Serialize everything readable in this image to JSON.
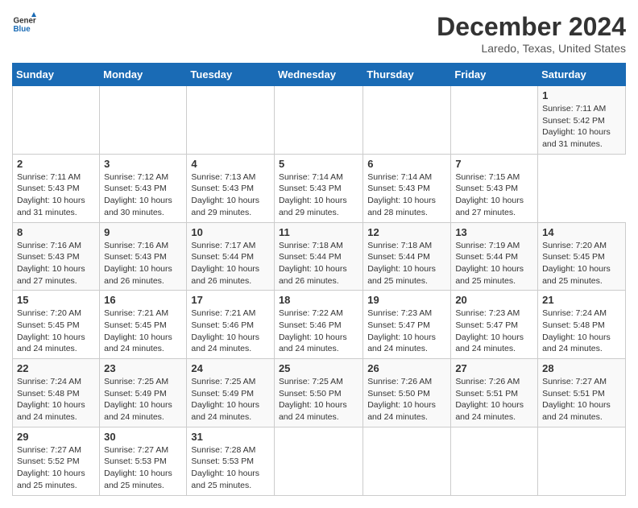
{
  "header": {
    "logo_line1": "General",
    "logo_line2": "Blue",
    "title": "December 2024",
    "subtitle": "Laredo, Texas, United States"
  },
  "calendar": {
    "days_of_week": [
      "Sunday",
      "Monday",
      "Tuesday",
      "Wednesday",
      "Thursday",
      "Friday",
      "Saturday"
    ],
    "weeks": [
      [
        {
          "day": "",
          "info": ""
        },
        {
          "day": "",
          "info": ""
        },
        {
          "day": "",
          "info": ""
        },
        {
          "day": "",
          "info": ""
        },
        {
          "day": "",
          "info": ""
        },
        {
          "day": "",
          "info": ""
        },
        {
          "day": "1",
          "info": "Sunrise: 7:11 AM\nSunset: 5:42 PM\nDaylight: 10 hours and 31 minutes."
        }
      ],
      [
        {
          "day": "2",
          "info": "Sunrise: 7:11 AM\nSunset: 5:43 PM\nDaylight: 10 hours and 31 minutes."
        },
        {
          "day": "3",
          "info": "Sunrise: 7:12 AM\nSunset: 5:43 PM\nDaylight: 10 hours and 30 minutes."
        },
        {
          "day": "4",
          "info": "Sunrise: 7:13 AM\nSunset: 5:43 PM\nDaylight: 10 hours and 29 minutes."
        },
        {
          "day": "5",
          "info": "Sunrise: 7:14 AM\nSunset: 5:43 PM\nDaylight: 10 hours and 29 minutes."
        },
        {
          "day": "6",
          "info": "Sunrise: 7:14 AM\nSunset: 5:43 PM\nDaylight: 10 hours and 28 minutes."
        },
        {
          "day": "7",
          "info": "Sunrise: 7:15 AM\nSunset: 5:43 PM\nDaylight: 10 hours and 27 minutes."
        }
      ],
      [
        {
          "day": "8",
          "info": "Sunrise: 7:16 AM\nSunset: 5:43 PM\nDaylight: 10 hours and 27 minutes."
        },
        {
          "day": "9",
          "info": "Sunrise: 7:16 AM\nSunset: 5:43 PM\nDaylight: 10 hours and 26 minutes."
        },
        {
          "day": "10",
          "info": "Sunrise: 7:17 AM\nSunset: 5:44 PM\nDaylight: 10 hours and 26 minutes."
        },
        {
          "day": "11",
          "info": "Sunrise: 7:18 AM\nSunset: 5:44 PM\nDaylight: 10 hours and 26 minutes."
        },
        {
          "day": "12",
          "info": "Sunrise: 7:18 AM\nSunset: 5:44 PM\nDaylight: 10 hours and 25 minutes."
        },
        {
          "day": "13",
          "info": "Sunrise: 7:19 AM\nSunset: 5:44 PM\nDaylight: 10 hours and 25 minutes."
        },
        {
          "day": "14",
          "info": "Sunrise: 7:20 AM\nSunset: 5:45 PM\nDaylight: 10 hours and 25 minutes."
        }
      ],
      [
        {
          "day": "15",
          "info": "Sunrise: 7:20 AM\nSunset: 5:45 PM\nDaylight: 10 hours and 24 minutes."
        },
        {
          "day": "16",
          "info": "Sunrise: 7:21 AM\nSunset: 5:45 PM\nDaylight: 10 hours and 24 minutes."
        },
        {
          "day": "17",
          "info": "Sunrise: 7:21 AM\nSunset: 5:46 PM\nDaylight: 10 hours and 24 minutes."
        },
        {
          "day": "18",
          "info": "Sunrise: 7:22 AM\nSunset: 5:46 PM\nDaylight: 10 hours and 24 minutes."
        },
        {
          "day": "19",
          "info": "Sunrise: 7:23 AM\nSunset: 5:47 PM\nDaylight: 10 hours and 24 minutes."
        },
        {
          "day": "20",
          "info": "Sunrise: 7:23 AM\nSunset: 5:47 PM\nDaylight: 10 hours and 24 minutes."
        },
        {
          "day": "21",
          "info": "Sunrise: 7:24 AM\nSunset: 5:48 PM\nDaylight: 10 hours and 24 minutes."
        }
      ],
      [
        {
          "day": "22",
          "info": "Sunrise: 7:24 AM\nSunset: 5:48 PM\nDaylight: 10 hours and 24 minutes."
        },
        {
          "day": "23",
          "info": "Sunrise: 7:25 AM\nSunset: 5:49 PM\nDaylight: 10 hours and 24 minutes."
        },
        {
          "day": "24",
          "info": "Sunrise: 7:25 AM\nSunset: 5:49 PM\nDaylight: 10 hours and 24 minutes."
        },
        {
          "day": "25",
          "info": "Sunrise: 7:25 AM\nSunset: 5:50 PM\nDaylight: 10 hours and 24 minutes."
        },
        {
          "day": "26",
          "info": "Sunrise: 7:26 AM\nSunset: 5:50 PM\nDaylight: 10 hours and 24 minutes."
        },
        {
          "day": "27",
          "info": "Sunrise: 7:26 AM\nSunset: 5:51 PM\nDaylight: 10 hours and 24 minutes."
        },
        {
          "day": "28",
          "info": "Sunrise: 7:27 AM\nSunset: 5:51 PM\nDaylight: 10 hours and 24 minutes."
        }
      ],
      [
        {
          "day": "29",
          "info": "Sunrise: 7:27 AM\nSunset: 5:52 PM\nDaylight: 10 hours and 25 minutes."
        },
        {
          "day": "30",
          "info": "Sunrise: 7:27 AM\nSunset: 5:53 PM\nDaylight: 10 hours and 25 minutes."
        },
        {
          "day": "31",
          "info": "Sunrise: 7:28 AM\nSunset: 5:53 PM\nDaylight: 10 hours and 25 minutes."
        },
        {
          "day": "",
          "info": ""
        },
        {
          "day": "",
          "info": ""
        },
        {
          "day": "",
          "info": ""
        },
        {
          "day": "",
          "info": ""
        }
      ]
    ]
  }
}
